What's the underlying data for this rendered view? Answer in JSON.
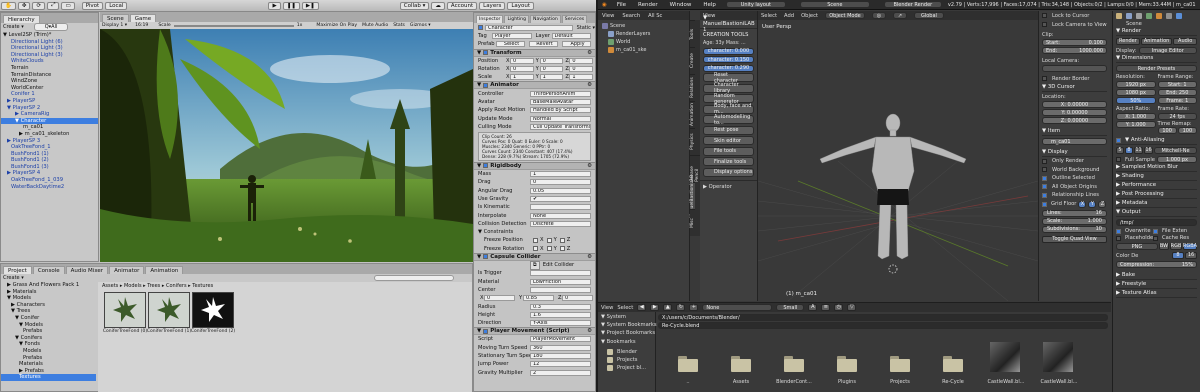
{
  "unity": {
    "toolbar": {
      "pivot": "Pivot",
      "local": "Local",
      "collab": "Collab ▾",
      "account": "Account",
      "layers": "Layers",
      "layout": "Layout"
    },
    "hierarchy": {
      "tab": "Hierarchy",
      "create": "Create ▾",
      "search": "Q▾All",
      "items": [
        {
          "text": "▼ Level2SP (Trim)*",
          "indent": 0,
          "blue": false,
          "sel": false
        },
        {
          "text": "Directional Light (6)",
          "indent": 2,
          "blue": true,
          "sel": false
        },
        {
          "text": "Directional Light (3)",
          "indent": 2,
          "blue": true,
          "sel": false
        },
        {
          "text": "Directional Light (3)",
          "indent": 2,
          "blue": true,
          "sel": false
        },
        {
          "text": "WhiteClouds",
          "indent": 2,
          "blue": true,
          "sel": false
        },
        {
          "text": "Terrain",
          "indent": 2,
          "blue": false,
          "sel": false
        },
        {
          "text": "TerrainDistance",
          "indent": 2,
          "blue": false,
          "sel": false
        },
        {
          "text": "WindZone",
          "indent": 2,
          "blue": false,
          "sel": false
        },
        {
          "text": "WorldCenter",
          "indent": 2,
          "blue": false,
          "sel": false
        },
        {
          "text": "Conifer 1",
          "indent": 2,
          "blue": true,
          "sel": false
        },
        {
          "text": "▶ PlayerSP",
          "indent": 1,
          "blue": true,
          "sel": false
        },
        {
          "text": "▼ PlayerSP 2",
          "indent": 1,
          "blue": true,
          "sel": false
        },
        {
          "text": "▶ CameraRig",
          "indent": 3,
          "blue": true,
          "sel": false
        },
        {
          "text": "▼ Character",
          "indent": 3,
          "blue": false,
          "sel": true
        },
        {
          "text": "m_ca01",
          "indent": 5,
          "blue": false,
          "sel": false
        },
        {
          "text": "▶ m_ca01_skeleton",
          "indent": 4,
          "blue": false,
          "sel": false
        },
        {
          "text": "▶ PlayerSP 3",
          "indent": 1,
          "blue": true,
          "sel": false
        },
        {
          "text": "OakTreeFond_1",
          "indent": 2,
          "blue": true,
          "sel": false
        },
        {
          "text": "BushFond1 (1)",
          "indent": 2,
          "blue": true,
          "sel": false
        },
        {
          "text": "BushFond1 (2)",
          "indent": 2,
          "blue": true,
          "sel": false
        },
        {
          "text": "BushFond1 (3)",
          "indent": 2,
          "blue": true,
          "sel": false
        },
        {
          "text": "▶ PlayerSP 4",
          "indent": 1,
          "blue": true,
          "sel": false
        },
        {
          "text": "OakTreeFond_1_039",
          "indent": 2,
          "blue": true,
          "sel": false
        },
        {
          "text": "WaterBackDaytime2",
          "indent": 2,
          "blue": true,
          "sel": false
        }
      ]
    },
    "game": {
      "tab_scene": "Scene",
      "tab_game": "Game",
      "display": "Display 1 ▾",
      "aspect": "16:19",
      "scale": "Scale",
      "scale_val": "1x",
      "maximize": "Maximize On Play",
      "mute": "Mute Audio",
      "stats": "Stats",
      "gizmos": "Gizmos ▾"
    },
    "inspector": {
      "tabs": [
        "Inspector",
        "Lighting",
        "Navigation",
        "Services"
      ],
      "object_name": "Character",
      "static": "Static ▾",
      "tag_label": "Tag",
      "tag_value": "Player",
      "layer_label": "Layer",
      "layer_value": "Default",
      "prefab_label": "Prefab",
      "prefab_buttons": [
        "Select",
        "Revert",
        "Apply"
      ],
      "transform": {
        "title": "Transform",
        "rows": [
          {
            "label": "Position",
            "x": "0",
            "y": "0",
            "z": "0"
          },
          {
            "label": "Rotation",
            "x": "0",
            "y": "0",
            "z": "0"
          },
          {
            "label": "Scale",
            "x": "1",
            "y": "1",
            "z": "1"
          }
        ]
      },
      "animator": {
        "title": "Animator",
        "rows": [
          {
            "label": "Controller",
            "value": "ThirdPersonAnim"
          },
          {
            "label": "Avatar",
            "value": "BaseMaleAvatar"
          },
          {
            "label": "Apply Root Motion",
            "value": "Handled by Script"
          },
          {
            "label": "Update Mode",
            "value": "Normal"
          },
          {
            "label": "Culling Mode",
            "value": "Cull Update Transforms"
          }
        ],
        "info": [
          "Clip Count: 26",
          "Curves Pos: 0 Quat: 0 Euler: 0 Scale: 0",
          "Muscles: 2340 Generic: 0 PPtr: 0",
          "Curves Count: 2340 Constant: 407 (17.4%)",
          "Dense: 228 (9.7%) Stream: 1705 (72.9%)"
        ]
      },
      "rigidbody": {
        "title": "Rigidbody",
        "rows": [
          {
            "label": "Mass",
            "value": "1"
          },
          {
            "label": "Drag",
            "value": "0"
          },
          {
            "label": "Angular Drag",
            "value": "0.05"
          },
          {
            "label": "Use Gravity",
            "value": "✔"
          },
          {
            "label": "Is Kinematic",
            "value": ""
          },
          {
            "label": "Interpolate",
            "value": "None"
          },
          {
            "label": "Collision Detection",
            "value": "Discrete"
          }
        ],
        "constraints": "▼ Constraints",
        "freeze_pos": "Freeze Position",
        "freeze_rot": "Freeze Rotation",
        "axes": [
          "X",
          "Y",
          "Z"
        ]
      },
      "capsule": {
        "title": "Capsule Collider",
        "edit": "Edit Collider",
        "rows": [
          {
            "label": "Is Trigger",
            "value": ""
          },
          {
            "label": "Material",
            "value": "LowFriction"
          },
          {
            "label": "Center",
            "value": ""
          }
        ],
        "center": {
          "x": "0",
          "y": "0.85",
          "z": "0"
        },
        "rows2": [
          {
            "label": "Radius",
            "value": "0.3"
          },
          {
            "label": "Height",
            "value": "1.6"
          },
          {
            "label": "Direction",
            "value": "Y-Axis"
          }
        ]
      },
      "player": {
        "title": "Player Movement (Script)",
        "rows": [
          {
            "label": "Script",
            "value": "PlayerMovement"
          },
          {
            "label": "Moving Turn Speed",
            "value": "360"
          },
          {
            "label": "Stationary Turn Speed",
            "value": "180"
          },
          {
            "label": "Jump Power",
            "value": "12"
          },
          {
            "label": "Gravity Multiplier",
            "value": "2"
          }
        ]
      }
    },
    "project": {
      "tabs": [
        "Project",
        "Console",
        "Audio Mixer",
        "Animator",
        "Animation"
      ],
      "create": "Create ▾",
      "tree": [
        {
          "text": "▶ Grass And Flowers Pack 1",
          "indent": 1
        },
        {
          "text": "▶ Materials",
          "indent": 1
        },
        {
          "text": "▼ Models",
          "indent": 1
        },
        {
          "text": "▶ Characters",
          "indent": 2
        },
        {
          "text": "▼ Trees",
          "indent": 2
        },
        {
          "text": "▼ Conifer",
          "indent": 3
        },
        {
          "text": "▼ Models",
          "indent": 4
        },
        {
          "text": "Prefabs",
          "indent": 5
        },
        {
          "text": "▼ Conifers",
          "indent": 3
        },
        {
          "text": "▼ Fonds",
          "indent": 4
        },
        {
          "text": "Models",
          "indent": 5
        },
        {
          "text": "Prefabs",
          "indent": 5
        },
        {
          "text": "Materials",
          "indent": 4
        },
        {
          "text": "▶ Prefabs",
          "indent": 4
        },
        {
          "text": "Textures",
          "indent": 4
        }
      ],
      "breadcrumb": "Assets ▸ Models ▸ Trees ▸ Conifers ▸ Textures",
      "assets": [
        "ConiferTreeFond (0)",
        "ConiferTreeFond (1)",
        "ConiferTreeFond (2)"
      ]
    }
  },
  "blender": {
    "menu": [
      "File",
      "Render",
      "Window",
      "Help"
    ],
    "layout": "Unity layout",
    "scene": "Scene",
    "engine": "Blender Render",
    "stats": "v2.79 | Verts:17,996 | Faces:17,074 | Tris:34,148 | Objects:0/2 | Lamps:0/0 | Mem:33.44M | m_ca01",
    "outliner": {
      "menu": [
        "View",
        "Search",
        "All Sc"
      ],
      "items": [
        {
          "text": "Scene",
          "indent": 0
        },
        {
          "text": "RenderLayers",
          "indent": 1
        },
        {
          "text": "World",
          "indent": 1
        },
        {
          "text": "m_ca01_ske",
          "indent": 1
        }
      ]
    },
    "vtabs": [
      "Tools",
      "Create",
      "Relations",
      "Animation",
      "Physics",
      "Grease Pencil",
      "ManuelBastioniLAB",
      "Misc"
    ],
    "toolshelf": {
      "title": "▼ ManuelBastioniLAB 1",
      "section": "CREATION TOOLS",
      "age": "Age: 33y  Mass: ...",
      "values": [
        "character: 0.000",
        "character: 0.150",
        "character: 0.290"
      ],
      "buttons": [
        "Reset character",
        "Character library",
        "Random generator",
        "Body, face and m...",
        "Automodelling to...",
        "Rest pose",
        "Skin editor",
        "File tools",
        "Finalize tools",
        "Display options"
      ],
      "operator": "▶ Operator"
    },
    "viewport": {
      "label": "User Persp",
      "object": "(1) m_ca01",
      "menus": [
        "View",
        "Select",
        "Add",
        "Object"
      ],
      "mode": "Object Mode",
      "pivot": "Global"
    },
    "npanel": {
      "lock_cursor": "Lock to Cursor",
      "lock_camera": "Lock Camera to View",
      "clip": "Clip:",
      "start_label": "Start:",
      "start_val": "0.100",
      "end_label": "End:",
      "end_val": "1000.000",
      "local_camera": "Local Camera:",
      "render_border": "Render Border",
      "cursor": "▼ 3D Cursor",
      "location": "Location:",
      "x": "X: 0.00000",
      "y": "Y: 0.00000",
      "z": "Z: 0.00000",
      "item": "▼ Item",
      "item_name": "m_ca01",
      "display": "▼ Display",
      "only_render": "Only Render",
      "world_bg": "World Background",
      "outline": "Outline Selected",
      "all_origins": "All Object Origins",
      "rel_lines": "Relationship Lines",
      "grid_floor": "Grid Floor",
      "x_chk": "X",
      "y_chk": "Y",
      "z_chk": "Z",
      "lines_label": "Lines:",
      "lines_val": "16",
      "scale_label": "Scale:",
      "scale_val": "1.000",
      "subdiv_label": "Subdivisions:",
      "subdiv_val": "10",
      "toggle_quad": "Toggle Quad View"
    },
    "properties": {
      "scene": "Scene",
      "render": "▼ Render",
      "render_buttons": [
        "Render",
        "Animation",
        "Audio"
      ],
      "display_label": "Display:",
      "display_val": "Image Editor",
      "dimensions": "▼ Dimensions",
      "render_presets": "Render Presets",
      "resolution": "Resolution:",
      "res_x": "1920 px",
      "res_y": "1080 px",
      "res_pct": "50%",
      "frame_range": "Frame Range:",
      "start": "Start: 1",
      "end": "End: 250",
      "frame": "Frame: 1",
      "aspect": "Aspect Ratio:",
      "asp_x": "X: 1.000",
      "asp_y": "Y: 1.000",
      "frame_rate": "Frame Rate:",
      "fps": "24 fps",
      "time_remap": "Time Remap:",
      "remap_a": "100",
      "remap_b": "100",
      "anti_alias": "▼ Anti-Aliasing",
      "aa_samples": [
        "5",
        "8",
        "11",
        "16"
      ],
      "filter": "Mitchell-Ne",
      "full_sample": "Full Sample",
      "filter_size": "1.000 px",
      "collapsed": [
        "▶ Sampled Motion Blur",
        "▶ Shading",
        "▶ Performance",
        "▶ Post Processing",
        "▶ Metadata"
      ],
      "output": "▼ Output",
      "output_path": "/tmp/",
      "overwrite": "Overwrite",
      "file_ext": "File Exten",
      "placeholders": "Placeholde",
      "cache": "Cache Res",
      "format": "PNG",
      "bw": "BW",
      "rgb": "RGB",
      "rgba": "RGBA",
      "color_depth": "Color De",
      "depth_a": "8",
      "depth_b": "16",
      "compression": "Compression:",
      "compression_val": "15%",
      "bottom": [
        "▶ Bake",
        "▶ Freestyle",
        "▶ Texture Atlas"
      ]
    },
    "filebrowser": {
      "header": [
        "View",
        "Select"
      ],
      "system": "▼ System",
      "system_bookmarks": "▼ System Bookmarks",
      "project_bookmarks": "▼ Project Bookmarks",
      "bookmarks": "▼ Bookmarks",
      "bm_items": [
        "Blender",
        "Projects",
        "Project bl..."
      ],
      "path": "X:/users/c/Documents/Blender/",
      "filename": "Re-Cycle.blend",
      "files": [
        "..",
        "Assets",
        "BlenderCont...",
        "Plugins",
        "Projects",
        "Re-Cycle",
        "CastleWall.bl...",
        "CastleWall.bl..."
      ],
      "display_mode": "None",
      "size": "Small"
    }
  }
}
